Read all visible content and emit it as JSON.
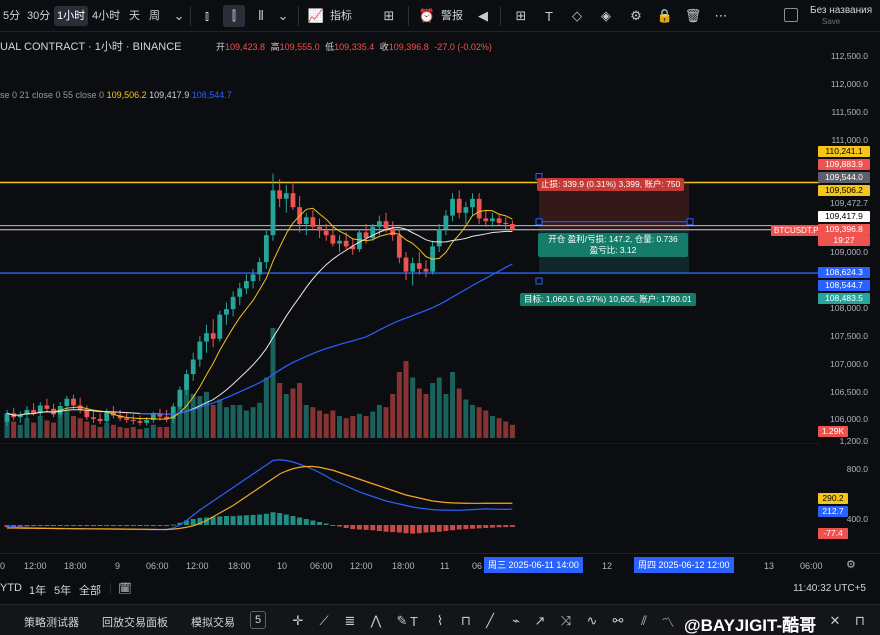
{
  "toolbar": {
    "timeframes": [
      {
        "label": "5分",
        "active": false
      },
      {
        "label": "30分",
        "active": false
      },
      {
        "label": "1小时",
        "active": true
      },
      {
        "label": "4小时",
        "active": false
      },
      {
        "label": "天",
        "active": false
      },
      {
        "label": "周",
        "active": false
      }
    ],
    "indicators_label": "指标",
    "alert_label": "警报",
    "workspace_title": "Без названия",
    "workspace_subtitle": "Save"
  },
  "legend": {
    "symbol": "UAL CONTRACT · 1小时 · BINANCE",
    "open_label": "开",
    "open": "109,423.8",
    "high_label": "高",
    "high": "109,555.0",
    "low_label": "低",
    "low": "109,335.4",
    "close_label": "收",
    "close": "109,396.8",
    "change": "-27.0 (-0.02%)",
    "indicator_text": "se 0 21 close 0 55 close 0",
    "ma_a": "109,506.2",
    "ma_b": "109,417.9",
    "ma_c": "108,544.7"
  },
  "price_scale": [
    "112,500.0",
    "112,000.0",
    "111,500.0",
    "111,000.0",
    "109,472.7",
    "109,000.0",
    "108,000.0",
    "107,500.0",
    "107,000.0",
    "106,500.0",
    "106,000.0",
    "1,200.0"
  ],
  "price_badges": {
    "b1": "110,241.1",
    "b2": "109,883.9",
    "b3": "109,544.0",
    "b4": "109,506.2",
    "b5": "109,417.9",
    "b6": "109,396.8",
    "b6_sub": "19:27",
    "b7": "108,624.3",
    "b8": "108,544.7",
    "b9": "108,483.5",
    "b10": "1.29K"
  },
  "trade": {
    "stop_tag": "止损: 339.9 (0.31%) 3,399, 账户: 750",
    "target_tag": "目标: 1,060.5 (0.97%) 10,605, 账户: 1780.01",
    "open_line1": "开仓 盈利/亏损: 147.2, 仓量: 0.736",
    "open_line2": "盈亏比: 3.12",
    "symbol_badge": "BTCUSDT.P"
  },
  "macd_scale": [
    "800.0",
    "400.0",
    "-400.0"
  ],
  "macd_badges": {
    "m1": "290.2",
    "m2": "212.7",
    "m3": "-77.4"
  },
  "time_axis": {
    "labels": [
      "0",
      "12:00",
      "18:00",
      "9",
      "06:00",
      "12:00",
      "18:00",
      "10",
      "06:00",
      "12:00",
      "18:00",
      "11",
      "06",
      "12",
      "13",
      "06:00"
    ],
    "range_start": "周三 2025-06-11 14:00",
    "range_end": "周四 2025-06-12 12:00"
  },
  "range_buttons": [
    "YTD",
    "1年",
    "5年",
    "全部"
  ],
  "clock": "11:40:32 UTC+5",
  "bottom_tabs": [
    "策略测试器",
    "回放交易面板",
    "模拟交易",
    "5"
  ],
  "watermark": "@BAYJIGIT-酷哥",
  "chart_data": {
    "type": "candlestick",
    "x": [
      "06-08 18:00",
      "06-09",
      "06-09 06:00",
      "06-09 12:00",
      "06-09 18:00",
      "06-10",
      "06-10 06:00",
      "06-10 12:00",
      "06-10 18:00",
      "06-11",
      "06-11 06:00"
    ],
    "ylim": [
      105900,
      112700
    ],
    "candles": [
      [
        105970,
        106180,
        105900,
        106120
      ],
      [
        106120,
        106220,
        106000,
        106050
      ],
      [
        106050,
        106150,
        105950,
        106100
      ],
      [
        106100,
        106250,
        106020,
        106180
      ],
      [
        106180,
        106300,
        106080,
        106120
      ],
      [
        106120,
        106320,
        106060,
        106260
      ],
      [
        106260,
        106380,
        106150,
        106200
      ],
      [
        106200,
        106290,
        106050,
        106100
      ],
      [
        106100,
        106320,
        106050,
        106250
      ],
      [
        106250,
        106430,
        106180,
        106380
      ],
      [
        106380,
        106450,
        106200,
        106260
      ],
      [
        106260,
        106400,
        106120,
        106180
      ],
      [
        106180,
        106260,
        106000,
        106050
      ],
      [
        106050,
        106150,
        105950,
        106020
      ],
      [
        106020,
        106120,
        105930,
        105980
      ],
      [
        105980,
        106200,
        105950,
        106150
      ],
      [
        106150,
        106250,
        106030,
        106080
      ],
      [
        106080,
        106180,
        105980,
        106030
      ],
      [
        106030,
        106120,
        105950,
        106000
      ],
      [
        106000,
        106100,
        105920,
        105980
      ],
      [
        105980,
        106080,
        105900,
        105950
      ],
      [
        105950,
        106050,
        105900,
        106000
      ],
      [
        106000,
        106150,
        105950,
        106100
      ],
      [
        106100,
        106200,
        105990,
        106060
      ],
      [
        106060,
        106180,
        105960,
        106020
      ],
      [
        106020,
        106300,
        105950,
        106240
      ],
      [
        106240,
        106600,
        106200,
        106540
      ],
      [
        106540,
        106900,
        106450,
        106820
      ],
      [
        106820,
        107200,
        106700,
        107080
      ],
      [
        107080,
        107500,
        106950,
        107400
      ],
      [
        107400,
        107700,
        107200,
        107550
      ],
      [
        107550,
        107800,
        107300,
        107450
      ],
      [
        107450,
        107950,
        107400,
        107880
      ],
      [
        107880,
        108100,
        107700,
        107980
      ],
      [
        107980,
        108300,
        107850,
        108200
      ],
      [
        108200,
        108450,
        108050,
        108350
      ],
      [
        108350,
        108600,
        108250,
        108480
      ],
      [
        108480,
        108700,
        108350,
        108600
      ],
      [
        108600,
        108900,
        108480,
        108820
      ],
      [
        108820,
        109400,
        108700,
        109300
      ],
      [
        109300,
        110400,
        109200,
        110100
      ],
      [
        110100,
        110300,
        109800,
        109950
      ],
      [
        109950,
        110200,
        109700,
        110050
      ],
      [
        110050,
        110250,
        109750,
        109800
      ],
      [
        109800,
        110000,
        109350,
        109500
      ],
      [
        109500,
        109700,
        109300,
        109620
      ],
      [
        109620,
        109750,
        109400,
        109450
      ],
      [
        109450,
        109600,
        109250,
        109380
      ],
      [
        109380,
        109500,
        109200,
        109300
      ],
      [
        109300,
        109450,
        109100,
        109150
      ],
      [
        109150,
        109300,
        109000,
        109200
      ],
      [
        109200,
        109350,
        109050,
        109100
      ],
      [
        109100,
        109250,
        108950,
        109050
      ],
      [
        109050,
        109400,
        109000,
        109350
      ],
      [
        109350,
        109500,
        109150,
        109250
      ],
      [
        109250,
        109500,
        109200,
        109450
      ],
      [
        109450,
        109650,
        109300,
        109550
      ],
      [
        109550,
        109700,
        109350,
        109420
      ],
      [
        109420,
        109550,
        109200,
        109300
      ],
      [
        109300,
        109400,
        108800,
        108900
      ],
      [
        108900,
        109000,
        108500,
        108650
      ],
      [
        108650,
        108900,
        108400,
        108800
      ],
      [
        108800,
        109000,
        108600,
        108700
      ],
      [
        108700,
        108850,
        108550,
        108650
      ],
      [
        108650,
        109200,
        108600,
        109100
      ],
      [
        109100,
        109500,
        109000,
        109400
      ],
      [
        109400,
        109750,
        109300,
        109650
      ],
      [
        109650,
        110050,
        109550,
        109950
      ],
      [
        109950,
        110100,
        109600,
        109700
      ],
      [
        109700,
        109900,
        109500,
        109800
      ],
      [
        109800,
        110050,
        109650,
        109950
      ],
      [
        109950,
        110050,
        109500,
        109600
      ],
      [
        109600,
        109750,
        109450,
        109550
      ],
      [
        109550,
        109700,
        109450,
        109600
      ],
      [
        109600,
        109680,
        109480,
        109520
      ],
      [
        109520,
        109620,
        109400,
        109500
      ],
      [
        109500,
        109560,
        109380,
        109400
      ]
    ],
    "volume": [
      0.2,
      0.15,
      0.12,
      0.18,
      0.14,
      0.2,
      0.16,
      0.14,
      0.22,
      0.25,
      0.2,
      0.18,
      0.15,
      0.12,
      0.1,
      0.14,
      0.12,
      0.1,
      0.09,
      0.1,
      0.08,
      0.09,
      0.12,
      0.1,
      0.1,
      0.2,
      0.35,
      0.45,
      0.4,
      0.38,
      0.42,
      0.3,
      0.35,
      0.28,
      0.3,
      0.3,
      0.25,
      0.28,
      0.32,
      0.55,
      1.0,
      0.5,
      0.4,
      0.45,
      0.5,
      0.3,
      0.28,
      0.25,
      0.22,
      0.25,
      0.2,
      0.18,
      0.2,
      0.22,
      0.2,
      0.24,
      0.3,
      0.28,
      0.4,
      0.6,
      0.7,
      0.55,
      0.45,
      0.4,
      0.5,
      0.55,
      0.4,
      0.6,
      0.45,
      0.35,
      0.3,
      0.28,
      0.25,
      0.2,
      0.18,
      0.15,
      0.12
    ],
    "levels": {
      "stop": 110241.1,
      "entry": 109396.8,
      "target": 108624.3
    },
    "macd_hist": [
      -30,
      -25,
      -20,
      -18,
      -15,
      -12,
      -10,
      -8,
      -6,
      -5,
      -8,
      -10,
      -12,
      -14,
      -12,
      -10,
      -9,
      -8,
      -7,
      -6,
      -5,
      -4,
      -4,
      -3,
      -2,
      5,
      30,
      60,
      80,
      95,
      100,
      110,
      115,
      120,
      118,
      125,
      130,
      135,
      140,
      150,
      170,
      160,
      140,
      120,
      100,
      80,
      60,
      40,
      20,
      0,
      -20,
      -40,
      -55,
      -60,
      -65,
      -70,
      -80,
      -90,
      -95,
      -100,
      -110,
      -115,
      -110,
      -100,
      -95,
      -90,
      -80,
      -70,
      -60,
      -55,
      -50,
      -45,
      -40,
      -35,
      -30,
      -28,
      -25
    ],
    "macd_line": [
      -20,
      -25,
      -30,
      -35,
      -38,
      -40,
      -42,
      -44,
      -45,
      -46,
      -48,
      -50,
      -52,
      -53,
      -54,
      -55,
      -56,
      -57,
      -58,
      -59,
      -60,
      -61,
      -62,
      -62,
      -60,
      -40,
      0,
      60,
      130,
      200,
      260,
      320,
      380,
      440,
      500,
      560,
      620,
      680,
      740,
      800,
      860,
      870,
      860,
      840,
      810,
      780,
      740,
      700,
      650,
      600,
      560,
      520,
      480,
      440,
      410,
      380,
      350,
      320,
      300,
      280,
      260,
      240,
      225,
      215,
      205,
      200,
      198,
      197,
      196,
      200,
      205,
      210,
      215,
      212,
      210,
      208,
      212.7
    ],
    "signal_line": [
      -40,
      -41,
      -42,
      -43,
      -44,
      -45,
      -46,
      -47,
      -48,
      -49,
      -50,
      -50,
      -51,
      -51,
      -52,
      -52,
      -53,
      -53,
      -54,
      -55,
      -56,
      -57,
      -58,
      -59,
      -60,
      -55,
      -45,
      -30,
      -10,
      20,
      60,
      110,
      160,
      210,
      260,
      320,
      380,
      440,
      500,
      560,
      620,
      680,
      720,
      750,
      770,
      780,
      780,
      770,
      750,
      730,
      700,
      670,
      640,
      610,
      580,
      550,
      520,
      490,
      460,
      430,
      400,
      380,
      360,
      340,
      320,
      310,
      300,
      295,
      292,
      290,
      289,
      289,
      290,
      290,
      290,
      290,
      290.2
    ]
  }
}
